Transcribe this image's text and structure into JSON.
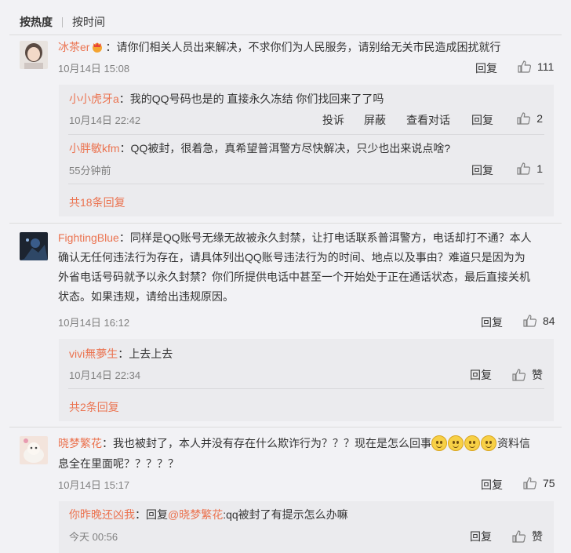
{
  "tabs": {
    "hot": "按热度",
    "time": "按时间"
  },
  "actions": {
    "reply": "回复",
    "report": "投诉",
    "block": "屏蔽",
    "view_conversation": "查看对话",
    "like": "赞"
  },
  "comments": [
    {
      "user": "冰茶er",
      "text": "：请你们相关人员出来解决，不求你们为人民服务，请别给无关市民造成困扰就行",
      "time": "10月14日 15:08",
      "likes": "111",
      "replies": [
        {
          "user": "小小虎牙a",
          "text": "：我的QQ号码也是的 直接永久冻结 你们找回来了了吗",
          "time": "10月14日 22:42",
          "likes": "2"
        },
        {
          "user": "小胖敏kfm",
          "text": "：QQ被封，很着急，真希望普洱警方尽快解决，只少也出来说点啥?",
          "time": "55分钟前",
          "likes": "1"
        }
      ],
      "more": "共18条回复"
    },
    {
      "user": "FightingBlue",
      "text_lines": [
        "：同样是QQ账号无缘无故被永久封禁，让打电话联系普洱警方，电话却打不通？本人",
        "确认无任何违法行为存在，请具体列出QQ账号违法行为的时间、地点以及事由？难道只是因为为",
        "外省电话号码就予以永久封禁？你们所提供电话中甚至一个开始处于正在通话状态，最后直接关机",
        "状态。如果违规，请给出违规原因。"
      ],
      "time": "10月14日 16:12",
      "likes": "84",
      "replies": [
        {
          "user": "vivi無夢生",
          "text": "：上去上去",
          "time": "10月14日 22:34"
        }
      ],
      "more": "共2条回复"
    },
    {
      "user": "晓梦繁花",
      "text_a": "：我也被封了，本人并没有存在什么欺诈行为？？？现在是怎么回事",
      "text_b": "资料信",
      "text_line2": "息全在里面呢？？？？？",
      "time": "10月14日 15:17",
      "likes": "75",
      "replies": [
        {
          "user": "你昨晚还凶我",
          "text_prefix": "：回复",
          "mention": "@晓梦繁花",
          "text": ":qq被封了有提示怎么办嘛",
          "time": "今天 00:56"
        }
      ]
    }
  ]
}
